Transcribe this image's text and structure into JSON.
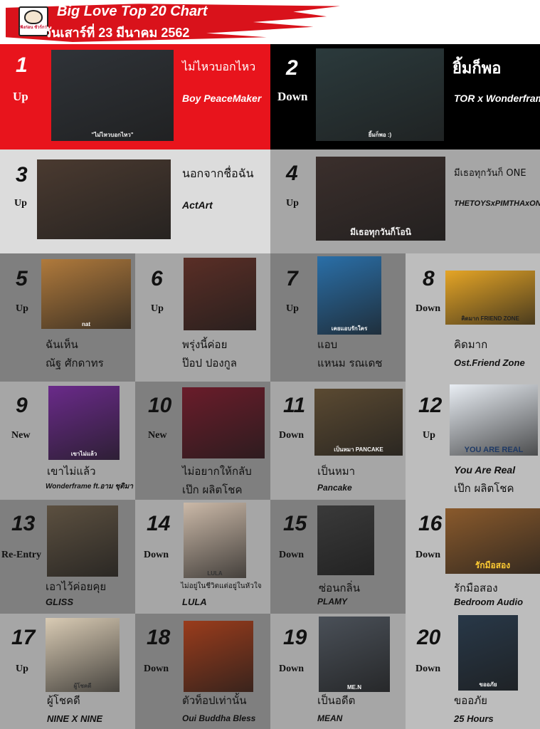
{
  "header": {
    "logo_text": "ฟังก่อน ชัวร์กว่า",
    "title": "Big Love Top 20 Chart",
    "date": "วันเสาร์ที่ 23 มีนาคม 2562"
  },
  "entries": [
    {
      "rank": "1",
      "status": "Up",
      "song": "ไม่ไหวบอกไหว",
      "artist": "Boy PeaceMaker",
      "cover_text": "\"ไม่ไหวบอกไหว\"",
      "cover_color": "#2f3338"
    },
    {
      "rank": "2",
      "status": "Down",
      "song": "ยิ้มก็พอ",
      "artist": "TOR x Wonderframe",
      "cover_text": "ยิ้มก็พอ :)",
      "cover_color": "#2b3a3c"
    },
    {
      "rank": "3",
      "status": "Up",
      "song": "นอกจากชื่อฉัน",
      "artist": "ActArt",
      "cover_text": "",
      "cover_color": "#4a3a30"
    },
    {
      "rank": "4",
      "status": "Up",
      "song": "มีเธอทุกวันก็ ONE",
      "artist": "THETOYSxPIMTHAxONE",
      "cover_text": "มีเธอทุกวันก็โอนิ",
      "cover_color": "#3b2f2c"
    },
    {
      "rank": "5",
      "status": "Up",
      "song": "ฉันเห็น",
      "artist": "ณัฐ ศักดาทร",
      "cover_text": "nat",
      "cover_color": "#b07a3c"
    },
    {
      "rank": "6",
      "status": "Up",
      "song": "พรุ่งนี้ค่อย",
      "artist": "ป๊อป ปองกูล",
      "cover_text": "",
      "cover_color": "#5a2e26"
    },
    {
      "rank": "7",
      "status": "Up",
      "song": "แอบ",
      "artist": "แหนม รณเดช",
      "cover_text": "เคยแอบรักใคร",
      "cover_color": "#2a6fa8"
    },
    {
      "rank": "8",
      "status": "Down",
      "song": "คิดมาก",
      "artist": "Ost.Friend Zone",
      "cover_text": "คิดมาก FRIEND ZONE",
      "cover_color": "#e5a526"
    },
    {
      "rank": "9",
      "status": "New",
      "song": "เขาไม่แล้ว",
      "artist": "Wonderframe ft.อาม ชุติมา",
      "cover_text": "เขาไม่แล้ว",
      "cover_color": "#6a2a8a"
    },
    {
      "rank": "10",
      "status": "New",
      "song": "ไม่อยากให้กลับ",
      "artist": "เป๊ก ผลิตโชค",
      "cover_text": "",
      "cover_color": "#6a1c2a"
    },
    {
      "rank": "11",
      "status": "Down",
      "song": "เป็นหมา",
      "artist": "Pancake",
      "cover_text": "เป็นหมา PANCAKE",
      "cover_color": "#5b4a32"
    },
    {
      "rank": "12",
      "status": "Up",
      "song": "You Are Real",
      "artist": "เป๊ก ผลิตโชค",
      "cover_text": "YOU ARE REAL",
      "cover_color": "#e9eef4"
    },
    {
      "rank": "13",
      "status": "Re-Entry",
      "song": "เอาไว้ค่อยคุย",
      "artist": "GLISS",
      "cover_text": "",
      "cover_color": "#5c5040"
    },
    {
      "rank": "14",
      "status": "Down",
      "song": "ไม่อยู่ในชีวิตแต่อยู่ในหัวใจ",
      "artist": "LULA",
      "cover_text": "LULA",
      "cover_color": "#cbb9a8"
    },
    {
      "rank": "15",
      "status": "Down",
      "song": "ซ่อนกลิ่น",
      "artist": "PLAMY",
      "cover_text": "",
      "cover_color": "#3a3a3a"
    },
    {
      "rank": "16",
      "status": "Down",
      "song": "รักมือสอง",
      "artist": "Bedroom Audio",
      "cover_text": "รักมือสอง",
      "cover_color": "#8a5a2c"
    },
    {
      "rank": "17",
      "status": "Up",
      "song": "ผู้โชคดี",
      "artist": "NINE X NINE",
      "cover_text": "ผู้โชคดี",
      "cover_color": "#d9cbb4"
    },
    {
      "rank": "18",
      "status": "Down",
      "song": "ตัวท็อปเท่านั้น",
      "artist": "Oui Buddha Bless",
      "cover_text": "",
      "cover_color": "#9a3c1c"
    },
    {
      "rank": "19",
      "status": "Down",
      "song": "เป็นอดีต",
      "artist": "MEAN",
      "cover_text": "ME.N",
      "cover_color": "#4a5058"
    },
    {
      "rank": "20",
      "status": "Down",
      "song": "ขออภัย",
      "artist": "25 Hours",
      "cover_text": "ขออภัย",
      "cover_color": "#283848"
    }
  ]
}
